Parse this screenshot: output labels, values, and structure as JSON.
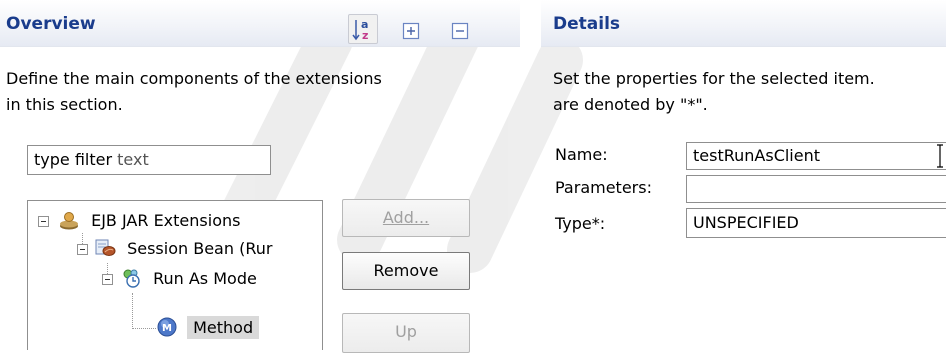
{
  "overview": {
    "title": "Overview",
    "description_line1": "Define the main components of the extensions",
    "description_line2": "in this section.",
    "filter": {
      "placeholder_prefix": "type filter",
      "placeholder_suffix": " text"
    },
    "toolbar": {
      "sort_icon": "sort-alphabetically-icon",
      "expand_icon": "expand-all-icon",
      "collapse_icon": "collapse-all-icon"
    },
    "tree": [
      {
        "label": "EJB JAR Extensions",
        "icon": "ejb-jar-icon",
        "level": 0,
        "expanded": true
      },
      {
        "label": "Session Bean (Rur",
        "icon": "session-bean-icon",
        "level": 1,
        "expanded": true
      },
      {
        "label": "Run As Mode",
        "icon": "run-as-mode-icon",
        "level": 2,
        "expanded": true
      },
      {
        "label": "Method",
        "icon": "method-icon",
        "level": 3,
        "selected": true
      }
    ],
    "buttons": {
      "add": "Add...",
      "remove": "Remove",
      "up": "Up"
    }
  },
  "details": {
    "title": "Details",
    "description_line1": "Set the properties for the selected item.",
    "description_line2": "are denoted by \"*\".",
    "fields": {
      "name_label": "Name:",
      "name_value": "testRunAsClient",
      "parameters_label": "Parameters:",
      "parameters_value": "",
      "type_label": "Type*:",
      "type_value": "UNSPECIFIED"
    }
  },
  "colors": {
    "section_title": "#1a3c8c",
    "selection": "#d9d9d9",
    "watermark": "#e8e8e8"
  }
}
